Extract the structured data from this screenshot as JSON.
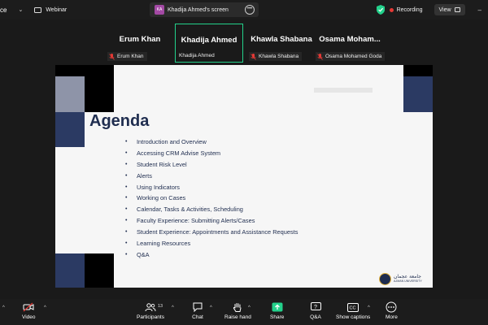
{
  "topbar": {
    "left_cut_label": "ce",
    "webinar_label": "Webinar",
    "screen_initials": "KA",
    "screen_title": "Khadija Ahmed's screen",
    "recording_label": "Recording",
    "view_label": "View",
    "minimize": "–"
  },
  "participants": [
    {
      "display": "Erum Khan",
      "tag": "Erum Khan",
      "active": false
    },
    {
      "display": "Khadija Ahmed",
      "tag": "Khadija Ahmed",
      "active": true
    },
    {
      "display": "Khawla Shabana",
      "tag": "Khawla Shabana",
      "active": false
    },
    {
      "display": "Osama  Moham...",
      "tag": "Osama Mohamed Goda",
      "active": false
    }
  ],
  "slide": {
    "title": "Agenda",
    "items": [
      "Introduction and Overview",
      "Accessing CRM Advise System",
      "Student Risk Level",
      "Alerts",
      "Using Indicators",
      "Working on Cases",
      "Calendar, Tasks & Activities, Scheduling",
      "Faculty Experience: Submitting Alerts/Cases",
      "Student Experience: Appointments and Assistance Requests",
      "Learning Resources",
      "Q&A"
    ],
    "logo_arabic": "جامعة عجمان",
    "logo_english": "AJMAN UNIVERSITY",
    "colors": {
      "navy": "#2b3a63",
      "gray_block": "#8e94a8",
      "black": "#000000",
      "background": "#f6f6f6"
    }
  },
  "toolbar": {
    "video_label": "Video",
    "participants_label": "Participants",
    "participants_count": "13",
    "chat_label": "Chat",
    "raise_hand_label": "Raise hand",
    "share_label": "Share",
    "qa_label": "Q&A",
    "captions_label": "Show captions",
    "more_label": "More",
    "share_color": "#23d18b",
    "video_off_color": "#e53935"
  }
}
